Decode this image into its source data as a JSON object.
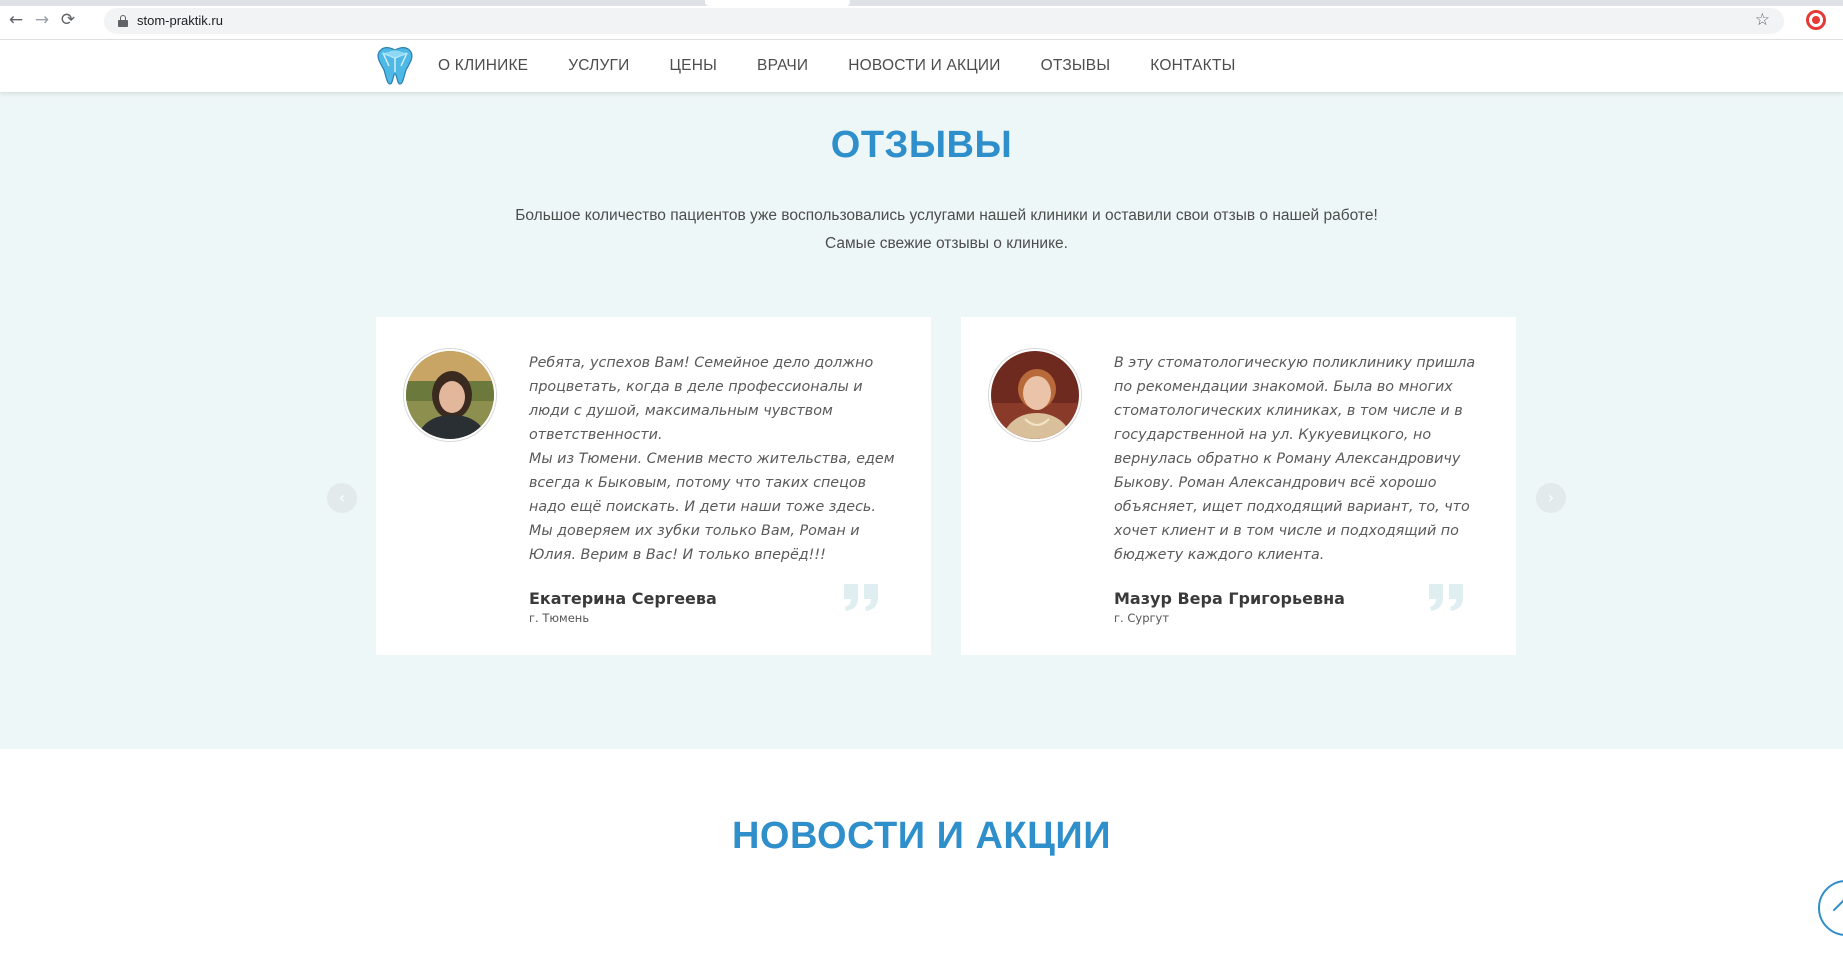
{
  "browser": {
    "url": "stom-praktik.ru",
    "back_icon": "arrow-left-icon",
    "forward_icon": "arrow-right-icon",
    "reload_icon": "reload-icon",
    "lock_icon": "lock-icon",
    "bookmark_icon": "star-icon"
  },
  "nav": {
    "items": [
      {
        "label": "О КЛИНИКЕ"
      },
      {
        "label": "УСЛУГИ"
      },
      {
        "label": "ЦЕНЫ"
      },
      {
        "label": "ВРАЧИ"
      },
      {
        "label": "НОВОСТИ И АКЦИИ"
      },
      {
        "label": "ОТЗЫВЫ"
      },
      {
        "label": "КОНТАКТЫ"
      }
    ]
  },
  "reviews": {
    "title": "ОТЗЫВЫ",
    "intro_line1": "Большое количество пациентов уже воспользовались услугами нашей клиники и оставили свои отзыв о нашей работе!",
    "intro_line2": "Самые свежие отзывы о клинике.",
    "items": [
      {
        "text": "Ребята, успехов Вам! Семейное дело должно процветать, когда в деле профессионалы и люди с душой, максимальным чувством ответственности.\nМы из Тюмени. Сменив место жительства, едем всегда к Быковым, потому что таких спецов надо ещё поискать. И дети наши тоже здесь. Мы доверяем их зубки только Вам, Роман и Юлия. Верим в Вас! И только вперёд!!!",
        "author": "Екатерина Сергеева",
        "city": "г. Тюмень"
      },
      {
        "text": "В эту стоматологическую поликлинику пришла по рекомендации знакомой. Была во многих стоматологических клиниках, в том числе и в государственной на ул. Кукуевицкого, но вернулась обратно к Роману Александровичу Быкову. Роман Александрович всё хорошо объясняет, ищет подходящий вариант, то, что хочет клиент и в том числе и подходящий по бюджету каждого клиента.",
        "author": "Мазур Вера Григорьевна",
        "city": "г. Сургут"
      }
    ],
    "prev_arrow": "‹",
    "next_arrow": "›"
  },
  "news": {
    "title": "НОВОСТИ И АКЦИИ"
  },
  "colors": {
    "accent": "#2f8fcb",
    "section_bg": "#eef7f8",
    "card_bg": "#ffffff"
  }
}
